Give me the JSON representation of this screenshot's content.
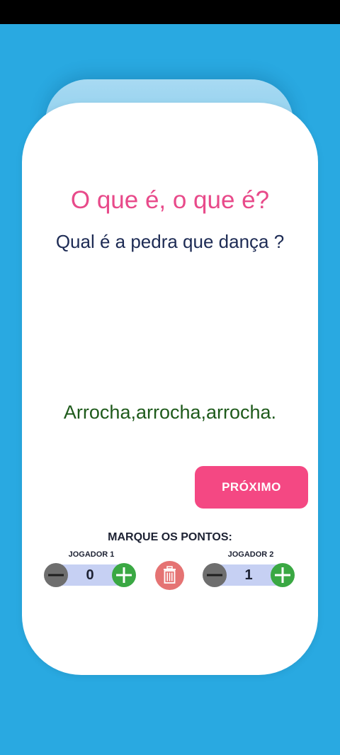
{
  "riddle": {
    "title": "O que é, o que é?",
    "question": "Qual é a pedra que dança ?",
    "answer": "Arrocha,arrocha,arrocha."
  },
  "actions": {
    "next_label": "PRÓXIMO"
  },
  "score": {
    "title": "MARQUE OS PONTOS:",
    "player1": {
      "label": "JOGADOR 1",
      "points": "0"
    },
    "player2": {
      "label": "JOGADOR 2",
      "points": "1"
    }
  },
  "icons": {
    "minus": "minus-icon",
    "plus": "plus-icon",
    "trash": "trash-icon"
  },
  "colors": {
    "background": "#29a9e1",
    "title": "#e84a8a",
    "question": "#1d2b54",
    "answer": "#1e5a1b",
    "next_button": "#f44883",
    "minus_button": "#6e6e6e",
    "plus_button": "#3aa843",
    "trash_button": "#e57373",
    "counter_track": "#c6d0f3"
  }
}
